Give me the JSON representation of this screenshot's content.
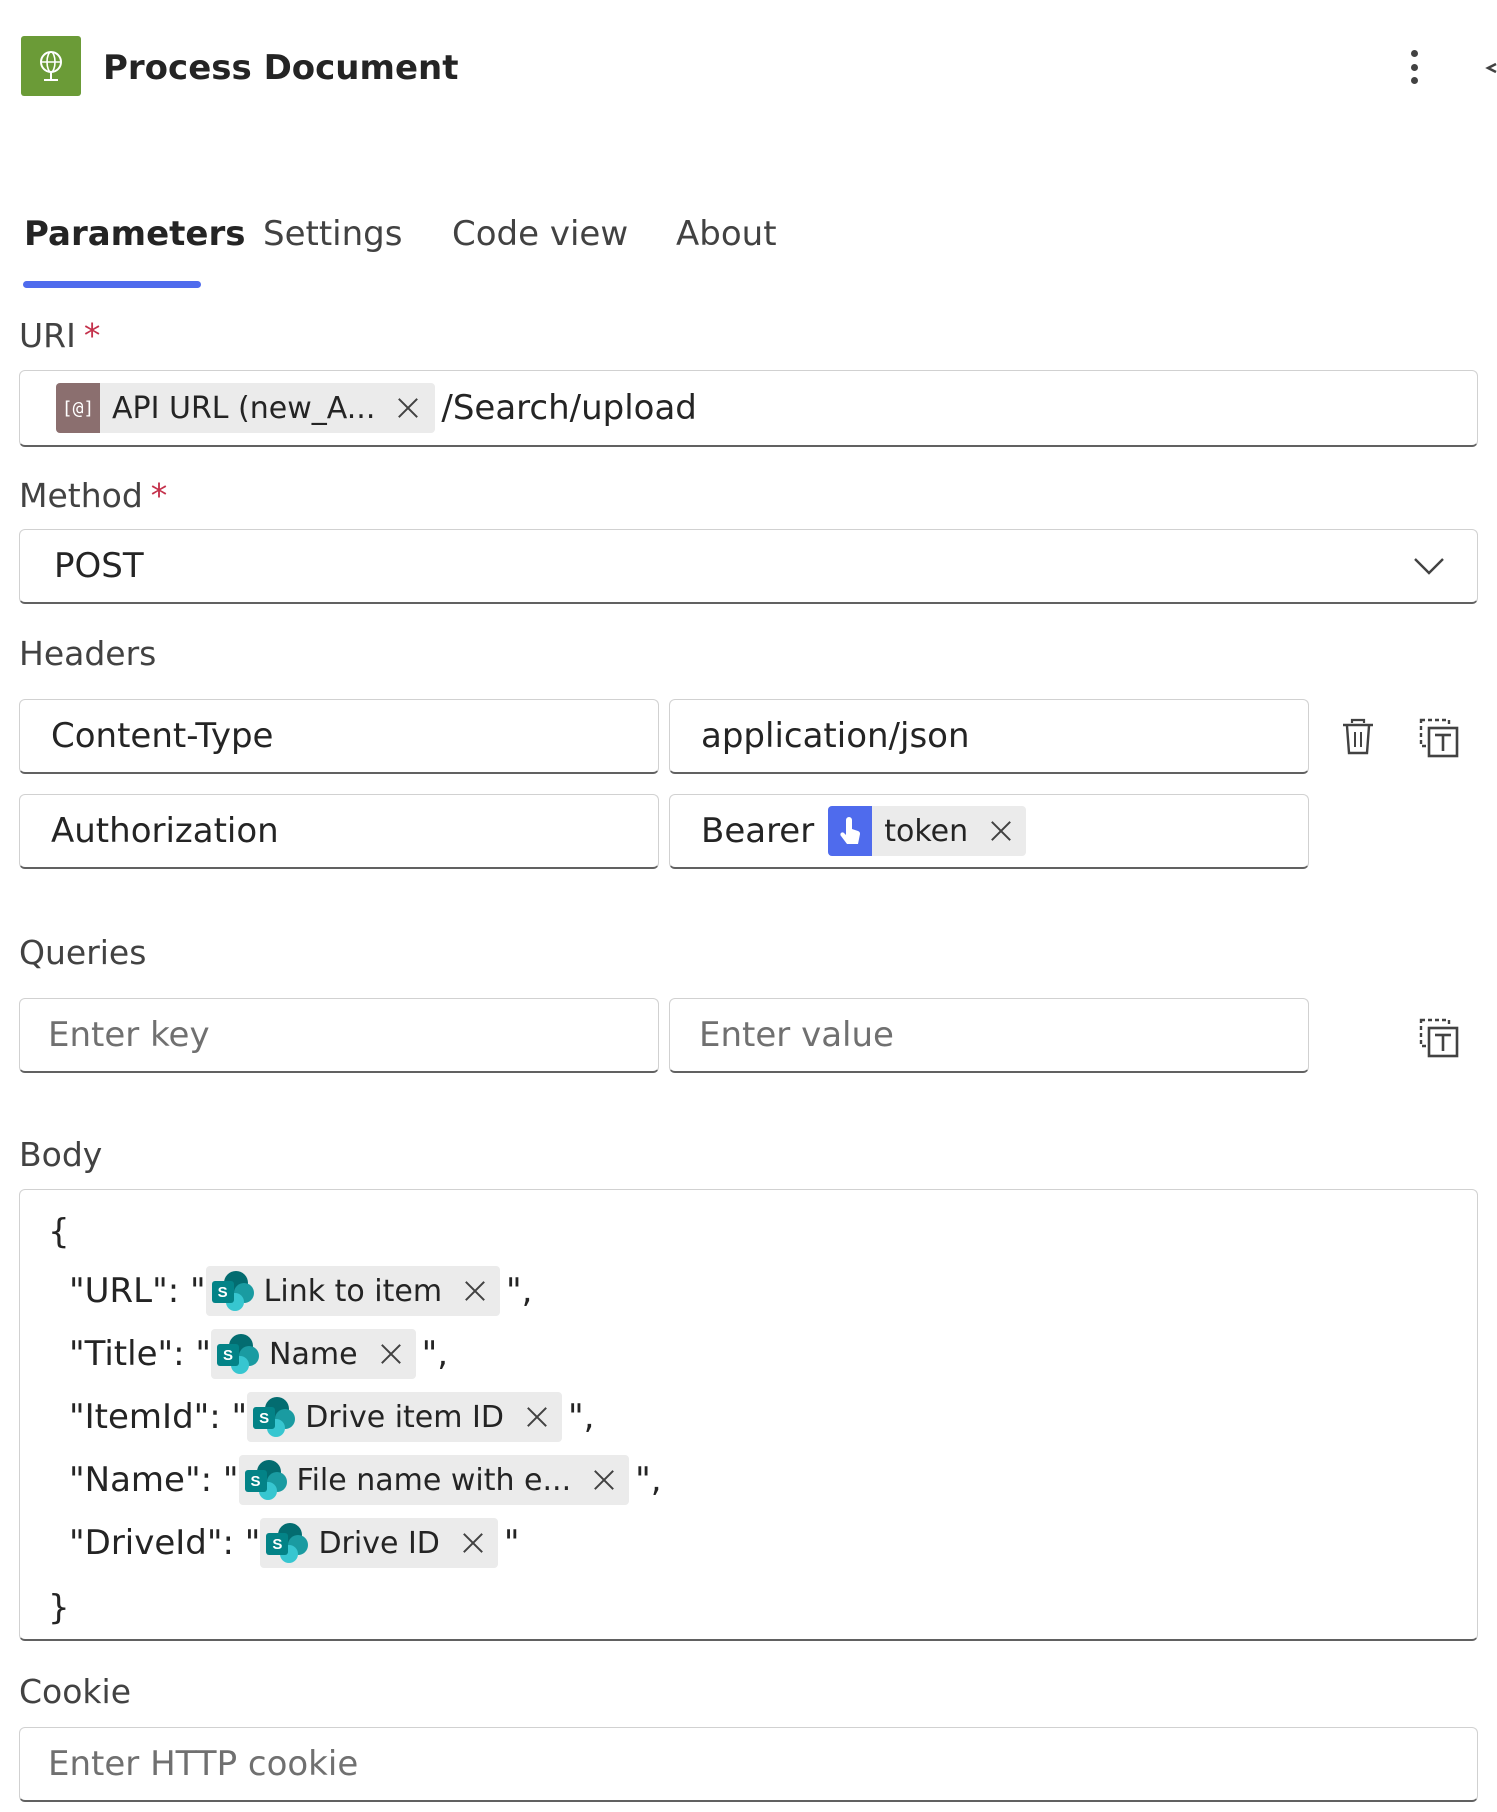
{
  "header": {
    "title": "Process Document",
    "icon": "globe-icon",
    "accent": "#6b9b37"
  },
  "tabs": [
    {
      "label": "Parameters",
      "active": true
    },
    {
      "label": "Settings",
      "active": false
    },
    {
      "label": "Code view",
      "active": false
    },
    {
      "label": "About",
      "active": false
    }
  ],
  "uri": {
    "label": "URI",
    "required_mark": "*",
    "token_label": "API URL (new_A...",
    "token_icon_text": "[@]",
    "suffix": "/Search/upload"
  },
  "method": {
    "label": "Method",
    "required_mark": "*",
    "value": "POST"
  },
  "headers": {
    "label": "Headers",
    "rows": [
      {
        "key": "Content-Type",
        "value": "application/json"
      },
      {
        "key": "Authorization",
        "value_prefix": "Bearer",
        "token_label": "token"
      }
    ]
  },
  "queries": {
    "label": "Queries",
    "key_placeholder": "Enter key",
    "value_placeholder": "Enter value"
  },
  "body": {
    "label": "Body",
    "open_brace": "{",
    "close_brace": "}",
    "lines": [
      {
        "prefix": "\"URL\": \"",
        "token": "Link to item",
        "suffix": "\","
      },
      {
        "prefix": "\"Title\": \"",
        "token": "Name",
        "suffix": "\","
      },
      {
        "prefix": "\"ItemId\": \"",
        "token": "Drive item ID",
        "suffix": "\","
      },
      {
        "prefix": "\"Name\": \"",
        "token": "File name with e...",
        "suffix": "\","
      },
      {
        "prefix": "\"DriveId\": \"",
        "token": "Drive ID",
        "suffix": "\""
      }
    ],
    "sp_icon_letter": "S"
  },
  "cookie": {
    "label": "Cookie",
    "placeholder": "Enter HTTP cookie"
  }
}
